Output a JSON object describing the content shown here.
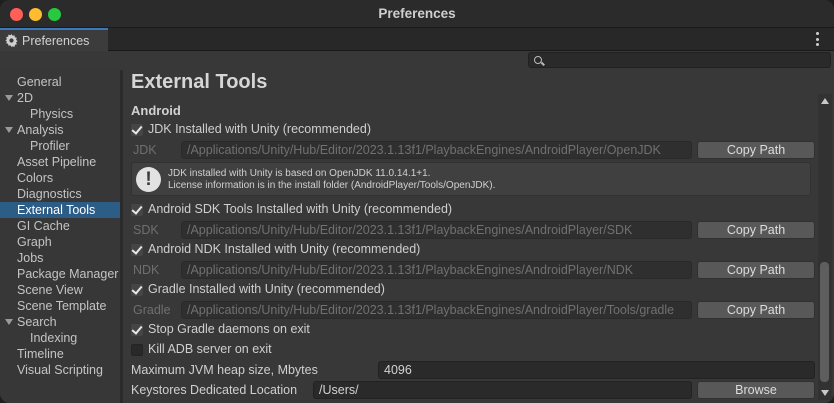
{
  "window": {
    "title": "Preferences"
  },
  "tab": {
    "label": "Preferences"
  },
  "search": {
    "value": ""
  },
  "sidebar": {
    "items": [
      {
        "label": "General",
        "level": 1,
        "expandable": false,
        "selected": false
      },
      {
        "label": "2D",
        "level": 1,
        "expandable": true,
        "selected": false
      },
      {
        "label": "Physics",
        "level": 2,
        "expandable": false,
        "selected": false
      },
      {
        "label": "Analysis",
        "level": 1,
        "expandable": true,
        "selected": false
      },
      {
        "label": "Profiler",
        "level": 2,
        "expandable": false,
        "selected": false
      },
      {
        "label": "Asset Pipeline",
        "level": 1,
        "expandable": false,
        "selected": false
      },
      {
        "label": "Colors",
        "level": 1,
        "expandable": false,
        "selected": false
      },
      {
        "label": "Diagnostics",
        "level": 1,
        "expandable": false,
        "selected": false
      },
      {
        "label": "External Tools",
        "level": 1,
        "expandable": false,
        "selected": true
      },
      {
        "label": "GI Cache",
        "level": 1,
        "expandable": false,
        "selected": false
      },
      {
        "label": "Graph",
        "level": 1,
        "expandable": false,
        "selected": false
      },
      {
        "label": "Jobs",
        "level": 1,
        "expandable": false,
        "selected": false
      },
      {
        "label": "Package Manager",
        "level": 1,
        "expandable": false,
        "selected": false
      },
      {
        "label": "Scene View",
        "level": 1,
        "expandable": false,
        "selected": false
      },
      {
        "label": "Scene Template",
        "level": 1,
        "expandable": false,
        "selected": false
      },
      {
        "label": "Search",
        "level": 1,
        "expandable": true,
        "selected": false
      },
      {
        "label": "Indexing",
        "level": 2,
        "expandable": false,
        "selected": false
      },
      {
        "label": "Timeline",
        "level": 1,
        "expandable": false,
        "selected": false
      },
      {
        "label": "Visual Scripting",
        "level": 1,
        "expandable": false,
        "selected": false
      }
    ]
  },
  "content": {
    "title": "External Tools",
    "section": "Android",
    "jdk": {
      "checkbox_label": "JDK Installed with Unity (recommended)",
      "checked": true,
      "path_label": "JDK",
      "path": "/Applications/Unity/Hub/Editor/2023.1.13f1/PlaybackEngines/AndroidPlayer/OpenJDK",
      "button": "Copy Path"
    },
    "info": {
      "line1": "JDK installed with Unity is based on OpenJDK 11.0.14.1+1.",
      "line2": "License information is in the install folder (AndroidPlayer/Tools/OpenJDK)."
    },
    "sdk": {
      "checkbox_label": "Android SDK Tools Installed with Unity (recommended)",
      "checked": true,
      "path_label": "SDK",
      "path": "/Applications/Unity/Hub/Editor/2023.1.13f1/PlaybackEngines/AndroidPlayer/SDK",
      "button": "Copy Path"
    },
    "ndk": {
      "checkbox_label": "Android NDK Installed with Unity (recommended)",
      "checked": true,
      "path_label": "NDK",
      "path": "/Applications/Unity/Hub/Editor/2023.1.13f1/PlaybackEngines/AndroidPlayer/NDK",
      "button": "Copy Path"
    },
    "gradle": {
      "checkbox_label": "Gradle Installed with Unity (recommended)",
      "checked": true,
      "path_label": "Gradle",
      "path": "/Applications/Unity/Hub/Editor/2023.1.13f1/PlaybackEngines/AndroidPlayer/Tools/gradle",
      "button": "Copy Path"
    },
    "stop_gradle": {
      "label": "Stop Gradle daemons on exit",
      "checked": true
    },
    "kill_adb": {
      "label": "Kill ADB server on exit",
      "checked": false
    },
    "jvm_heap": {
      "label": "Maximum JVM heap size, Mbytes",
      "value": "4096"
    },
    "keystores": {
      "label": "Keystores Dedicated Location",
      "value": "/Users/",
      "button": "Browse"
    }
  },
  "colors": {
    "selection": "#2c5d87",
    "accent_tab": "#3a79bb",
    "close": "#fe5f57",
    "minimize": "#febc2e",
    "maximize": "#28c840"
  }
}
